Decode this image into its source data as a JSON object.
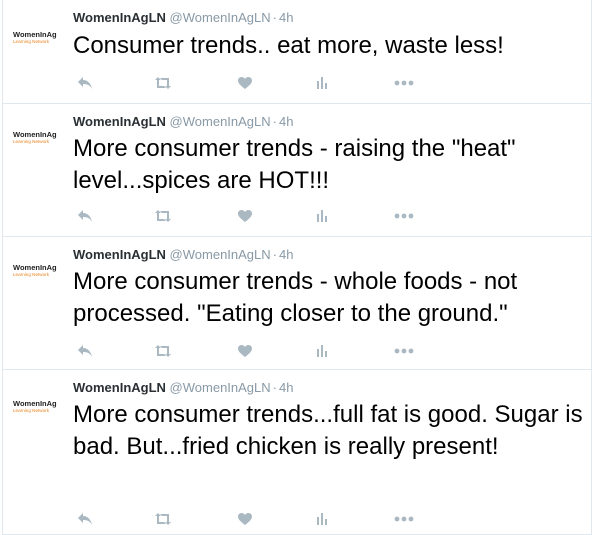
{
  "colors": {
    "name": "#292f33",
    "meta": "#8899a6",
    "icon": "#aab8c2",
    "border": "#e1e8ed",
    "brand_orange": "#e8811a"
  },
  "tweets": [
    {
      "avatar_brand": "WomenInAg",
      "avatar_sub": "Learning Network",
      "name": "WomenInAgLN",
      "handle": "@WomenInAgLN",
      "separator": "·",
      "time": "4h",
      "text": "Consumer trends.. eat more, waste less!",
      "icons": [
        "reply-icon",
        "retweet-icon",
        "like-icon",
        "analytics-icon",
        "more-icon"
      ]
    },
    {
      "avatar_brand": "WomenInAg",
      "avatar_sub": "Learning Network",
      "name": "WomenInAgLN",
      "handle": "@WomenInAgLN",
      "separator": "·",
      "time": "4h",
      "text": "More consumer trends - raising the \"heat\" level...spices are HOT!!!",
      "icons": [
        "reply-icon",
        "retweet-icon",
        "like-icon",
        "analytics-icon",
        "more-icon"
      ]
    },
    {
      "avatar_brand": "WomenInAg",
      "avatar_sub": "Learning Network",
      "name": "WomenInAgLN",
      "handle": "@WomenInAgLN",
      "separator": "·",
      "time": "4h",
      "text": "More consumer trends - whole foods - not processed. \"Eating closer to the ground.\"",
      "icons": [
        "reply-icon",
        "retweet-icon",
        "like-icon",
        "analytics-icon",
        "more-icon"
      ]
    },
    {
      "avatar_brand": "WomenInAg",
      "avatar_sub": "Learning Network",
      "name": "WomenInAgLN",
      "handle": "@WomenInAgLN",
      "separator": "·",
      "time": "4h",
      "text": "More consumer trends...full fat is good. Sugar is bad. But...fried chicken is really present!",
      "icons": [
        "reply-icon",
        "retweet-icon",
        "like-icon",
        "analytics-icon",
        "more-icon"
      ]
    }
  ]
}
